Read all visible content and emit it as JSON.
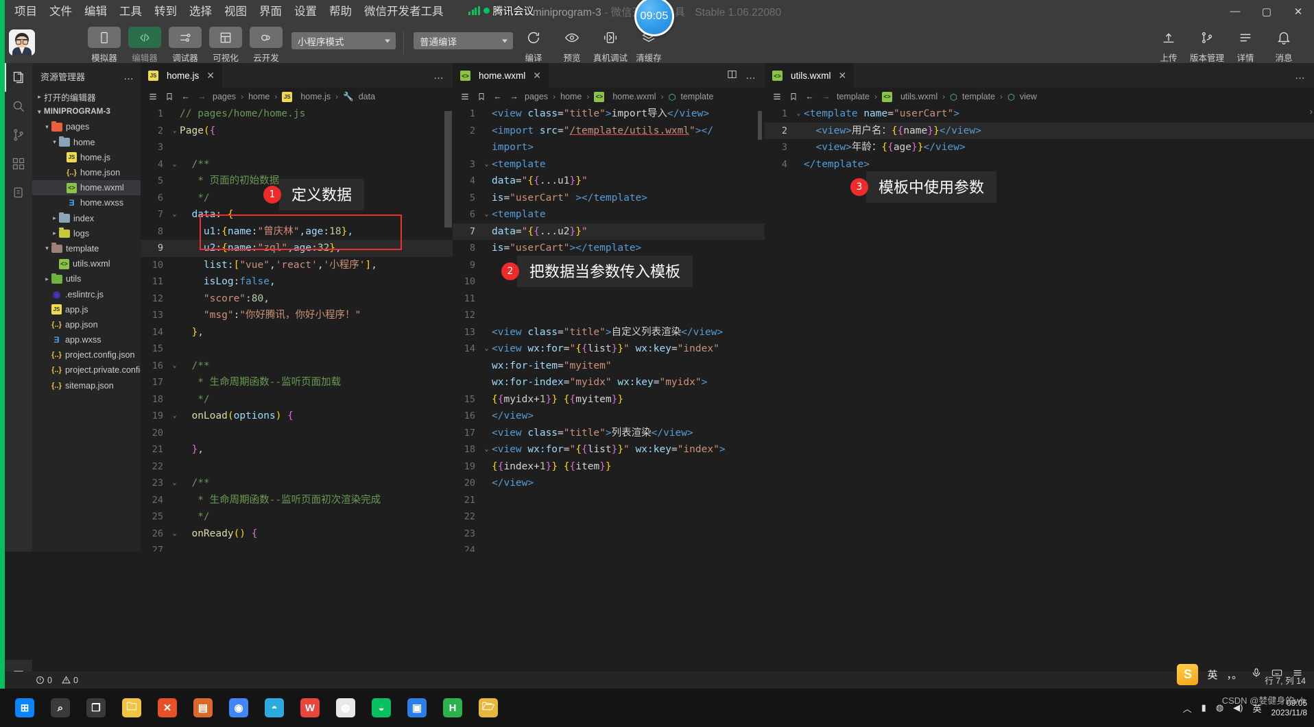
{
  "window": {
    "title_project": "miniprogram-3",
    "title_sep": " - ",
    "title_app": "微信开发者工具",
    "title_version": "Stable 1.06.22080",
    "minimize": "—",
    "maximize": "▢",
    "close": "✕"
  },
  "overlay": {
    "meeting_label": "腾讯会议",
    "clock": "09:05"
  },
  "menubar": {
    "items": [
      "项目",
      "文件",
      "编辑",
      "工具",
      "转到",
      "选择",
      "视图",
      "界面",
      "设置",
      "帮助",
      "微信开发者工具"
    ]
  },
  "toolbar": {
    "buttons": [
      {
        "label": "模拟器",
        "icon": "phone-icon",
        "active": false
      },
      {
        "label": "编辑器",
        "icon": "code-icon",
        "active": true
      },
      {
        "label": "调试器",
        "icon": "sliders-icon",
        "active": false
      },
      {
        "label": "可视化",
        "icon": "layout-icon",
        "active": false
      },
      {
        "label": "云开发",
        "icon": "cloud-icon",
        "active": false
      }
    ],
    "mode_select": "小程序模式",
    "compile_select": "普通编译",
    "actions": [
      {
        "label": "编译",
        "icon": "refresh-icon"
      },
      {
        "label": "预览",
        "icon": "eye-icon"
      },
      {
        "label": "真机调试",
        "icon": "device-debug-icon"
      },
      {
        "label": "清缓存",
        "icon": "layers-icon"
      }
    ],
    "right_actions": [
      {
        "label": "上传",
        "icon": "upload-icon"
      },
      {
        "label": "版本管理",
        "icon": "branch-icon"
      },
      {
        "label": "详情",
        "icon": "details-icon"
      },
      {
        "label": "消息",
        "icon": "bell-icon"
      }
    ]
  },
  "activity_bar": {
    "items": [
      {
        "name": "explorer-icon",
        "glyph": "files"
      },
      {
        "name": "search-icon",
        "glyph": "search"
      },
      {
        "name": "source-control-icon",
        "glyph": "branch"
      },
      {
        "name": "extensions-icon",
        "glyph": "blocks"
      },
      {
        "name": "debug-icon",
        "glyph": "bug"
      }
    ],
    "bottom": {
      "name": "menu-icon",
      "glyph": "list"
    }
  },
  "explorer": {
    "title": "资源管理器",
    "more": "…",
    "open_editors": "打开的编辑器",
    "project_name": "MINIPROGRAM-3",
    "tree": [
      {
        "label": "pages",
        "depth": 1,
        "type": "folder",
        "color": "#e8603c",
        "arrow": "▾"
      },
      {
        "label": "home",
        "depth": 2,
        "type": "folder",
        "color": "#8aa4b8",
        "arrow": "▾"
      },
      {
        "label": "home.js",
        "depth": 3,
        "type": "js",
        "arrow": ""
      },
      {
        "label": "home.json",
        "depth": 3,
        "type": "json",
        "arrow": ""
      },
      {
        "label": "home.wxml",
        "depth": 3,
        "type": "wxml",
        "arrow": "",
        "selected": true
      },
      {
        "label": "home.wxss",
        "depth": 3,
        "type": "wxss",
        "arrow": ""
      },
      {
        "label": "index",
        "depth": 2,
        "type": "folder",
        "color": "#8aa4b8",
        "arrow": "▸"
      },
      {
        "label": "logs",
        "depth": 2,
        "type": "folder",
        "color": "#c8c83c",
        "arrow": "▸"
      },
      {
        "label": "template",
        "depth": 1,
        "type": "folder",
        "color": "#9b8274",
        "arrow": "▾"
      },
      {
        "label": "utils.wxml",
        "depth": 2,
        "type": "wxml",
        "arrow": ""
      },
      {
        "label": "utils",
        "depth": 1,
        "type": "folder",
        "color": "#6cb33f",
        "arrow": "▸"
      },
      {
        "label": ".eslintrc.js",
        "depth": 1,
        "type": "eslint",
        "arrow": ""
      },
      {
        "label": "app.js",
        "depth": 1,
        "type": "js",
        "arrow": ""
      },
      {
        "label": "app.json",
        "depth": 1,
        "type": "json",
        "arrow": ""
      },
      {
        "label": "app.wxss",
        "depth": 1,
        "type": "wxss",
        "arrow": ""
      },
      {
        "label": "project.config.json",
        "depth": 1,
        "type": "json",
        "arrow": ""
      },
      {
        "label": "project.private.config.json",
        "depth": 1,
        "type": "json",
        "arrow": ""
      },
      {
        "label": "sitemap.json",
        "depth": 1,
        "type": "json",
        "arrow": ""
      }
    ]
  },
  "editor_js": {
    "tab": {
      "label": "home.js",
      "close": "✕"
    },
    "tab_more": "…",
    "breadcrumb": [
      "pages",
      "home",
      "home.js",
      "data"
    ],
    "lines": [
      {
        "n": "1",
        "fold": "",
        "html": "<span class='t-cmt'>// pages/home/home.js</span>"
      },
      {
        "n": "2",
        "fold": "⌄",
        "html": "<span class='t-fn'>Page</span><span class='t-br1'>(</span><span class='t-br2'>{</span>"
      },
      {
        "n": "3",
        "fold": "",
        "html": ""
      },
      {
        "n": "4",
        "fold": "⌄",
        "html": "  <span class='t-cmt'>/**</span>"
      },
      {
        "n": "5",
        "fold": "",
        "html": "   <span class='t-cmt'>* 页面的初始数据</span>"
      },
      {
        "n": "6",
        "fold": "",
        "html": "   <span class='t-cmt'>*/</span>"
      },
      {
        "n": "7",
        "fold": "⌄",
        "html": "  <span class='t-var'>data</span><span class='t-pln'>: </span><span class='t-br1'>{</span>"
      },
      {
        "n": "8",
        "fold": "",
        "html": "    <span class='t-var'>u1</span><span class='t-pln'>:</span><span class='t-br1'>{</span><span class='t-var'>name</span><span class='t-pln'>:</span><span class='t-str'>\"曾庆林\"</span><span class='t-var'>,age</span><span class='t-pln'>:</span><span class='t-num'>18</span><span class='t-br1'>}</span><span class='t-var'>,</span>"
      },
      {
        "n": "9",
        "fold": "",
        "html": "    <span class='t-var'>u2</span><span class='t-pln'>:</span><span class='t-br1'>{</span><span class='t-var'>name</span><span class='t-pln'>:</span><span class='t-str'>\"zql\"</span><span class='t-var'>,age</span><span class='t-pln'>:</span><span class='t-num'>32</span><span class='t-br1'>}</span><span class='t-var'>,</span>",
        "hl": true
      },
      {
        "n": "10",
        "fold": "",
        "html": "    <span class='t-var'>list</span><span class='t-pln'>:</span><span class='t-br1'>[</span><span class='t-str'>\"vue\"</span><span class='t-pln'>,</span><span class='t-str'>'react'</span><span class='t-pln'>,</span><span class='t-str'>'小程序'</span><span class='t-br1'>]</span><span class='t-var'>,</span>"
      },
      {
        "n": "11",
        "fold": "",
        "html": "    <span class='t-var'>isLog</span><span class='t-pln'>:</span><span class='t-lit'>false</span><span class='t-var'>,</span>"
      },
      {
        "n": "12",
        "fold": "",
        "html": "    <span class='t-str'>\"score\"</span><span class='t-pln'>:</span><span class='t-num'>80</span><span class='t-var'>,</span>"
      },
      {
        "n": "13",
        "fold": "",
        "html": "    <span class='t-str'>\"msg\"</span><span class='t-pln'>:</span><span class='t-str'>\"你好腾讯，你好小程序！\"</span>"
      },
      {
        "n": "14",
        "fold": "",
        "html": "  <span class='t-br1'>}</span><span class='t-var'>,</span>"
      },
      {
        "n": "15",
        "fold": "",
        "html": ""
      },
      {
        "n": "16",
        "fold": "⌄",
        "html": "  <span class='t-cmt'>/**</span>"
      },
      {
        "n": "17",
        "fold": "",
        "html": "   <span class='t-cmt'>* 生命周期函数--监听页面加载</span>"
      },
      {
        "n": "18",
        "fold": "",
        "html": "   <span class='t-cmt'>*/</span>"
      },
      {
        "n": "19",
        "fold": "⌄",
        "html": "  <span class='t-fn'>onLoad</span><span class='t-br1'>(</span><span class='t-var'>options</span><span class='t-br1'>)</span><span class='t-pln'> </span><span class='t-br2'>{</span>"
      },
      {
        "n": "20",
        "fold": "",
        "html": ""
      },
      {
        "n": "21",
        "fold": "",
        "html": "  <span class='t-br2'>}</span><span class='t-var'>,</span>"
      },
      {
        "n": "22",
        "fold": "",
        "html": ""
      },
      {
        "n": "23",
        "fold": "⌄",
        "html": "  <span class='t-cmt'>/**</span>"
      },
      {
        "n": "24",
        "fold": "",
        "html": "   <span class='t-cmt'>* 生命周期函数--监听页面初次渲染完成</span>"
      },
      {
        "n": "25",
        "fold": "",
        "html": "   <span class='t-cmt'>*/</span>"
      },
      {
        "n": "26",
        "fold": "⌄",
        "html": "  <span class='t-fn'>onReady</span><span class='t-br1'>()</span><span class='t-pln'> </span><span class='t-br2'>{</span>"
      },
      {
        "n": "27",
        "fold": "",
        "html": ""
      }
    ]
  },
  "editor_wxml": {
    "tab": {
      "label": "home.wxml",
      "close": "✕"
    },
    "split_icon": "split-editor-icon",
    "tab_more": "…",
    "breadcrumb": [
      "pages",
      "home",
      "home.wxml",
      "template"
    ],
    "lines": [
      {
        "n": "1",
        "fold": "",
        "html": "<span class='t-tag'>&lt;view</span> <span class='t-attr'>class</span>=<span class='t-str'>\"title\"</span><span class='t-tag'>&gt;</span><span class='t-pln'>import导入</span><span class='t-tag'>&lt;/view&gt;</span>"
      },
      {
        "n": "2",
        "fold": "",
        "html": "<span class='t-tag'>&lt;import</span> <span class='t-attr'>src</span>=<span class='t-str'>\"</span><span class='t-link'>/template/utils.wxml</span><span class='t-str'>\"</span><span class='t-tag'>&gt;&lt;/</span>"
      },
      {
        "n": "",
        "fold": "",
        "html": "<span class='t-tag'>import&gt;</span>"
      },
      {
        "n": "3",
        "fold": "⌄",
        "html": "<span class='t-tag'>&lt;template</span>"
      },
      {
        "n": "4",
        "fold": "",
        "html": "<span class='t-attr'>data</span>=<span class='t-str'>\"</span><span class='t-br1'>{</span><span class='t-br2'>{</span><span class='t-pln'>...u1</span><span class='t-br2'>}</span><span class='t-br1'>}</span><span class='t-str'>\"</span>"
      },
      {
        "n": "5",
        "fold": "",
        "html": "<span class='t-attr'>is</span>=<span class='t-str'>\"userCart\"</span> <span class='t-tag'>&gt;&lt;/template&gt;</span>"
      },
      {
        "n": "6",
        "fold": "⌄",
        "html": "<span class='t-tag'>&lt;template</span>"
      },
      {
        "n": "7",
        "fold": "",
        "html": "<span class='t-attr'>data</span>=<span class='t-str'>\"</span><span class='t-br1'>{</span><span class='t-br2'>{</span><span class='t-pln'>...u2</span><span class='t-br2'>}</span><span class='t-br1'>}</span><span class='t-str'>\"</span>",
        "hl": true
      },
      {
        "n": "8",
        "fold": "",
        "html": "<span class='t-attr'>is</span>=<span class='t-str'>\"userCart\"</span><span class='t-tag'>&gt;&lt;/template&gt;</span>"
      },
      {
        "n": "9",
        "fold": "",
        "html": ""
      },
      {
        "n": "10",
        "fold": "",
        "html": ""
      },
      {
        "n": "11",
        "fold": "",
        "html": ""
      },
      {
        "n": "12",
        "fold": "",
        "html": ""
      },
      {
        "n": "13",
        "fold": "",
        "html": "<span class='t-tag'>&lt;view</span> <span class='t-attr'>class</span>=<span class='t-str'>\"title\"</span><span class='t-tag'>&gt;</span><span class='t-pln'>自定义列表渲染</span><span class='t-tag'>&lt;/view&gt;</span>"
      },
      {
        "n": "14",
        "fold": "⌄",
        "html": "<span class='t-tag'>&lt;view</span> <span class='t-attr'>wx:for</span>=<span class='t-str'>\"</span><span class='t-br1'>{</span><span class='t-br2'>{</span><span class='t-pln'>list</span><span class='t-br2'>}</span><span class='t-br1'>}</span><span class='t-str'>\"</span> <span class='t-attr'>wx:key</span>=<span class='t-str'>\"index\"</span>"
      },
      {
        "n": "",
        "fold": "",
        "html": "<span class='t-attr'>wx:for-item</span>=<span class='t-str'>\"myitem\"</span>"
      },
      {
        "n": "",
        "fold": "",
        "html": "<span class='t-attr'>wx:for-index</span>=<span class='t-str'>\"myidx\"</span> <span class='t-attr'>wx:key</span>=<span class='t-str'>\"myidx\"</span><span class='t-tag'>&gt;</span>"
      },
      {
        "n": "15",
        "fold": "",
        "html": "<span class='t-br1'>{</span><span class='t-br2'>{</span><span class='t-pln'>myidx+</span><span class='t-num'>1</span><span class='t-br2'>}</span><span class='t-br1'>}</span> <span class='t-br1'>{</span><span class='t-br2'>{</span><span class='t-pln'>myitem</span><span class='t-br2'>}</span><span class='t-br1'>}</span>"
      },
      {
        "n": "16",
        "fold": "",
        "html": "<span class='t-tag'>&lt;/view&gt;</span>"
      },
      {
        "n": "17",
        "fold": "",
        "html": "<span class='t-tag'>&lt;view</span> <span class='t-attr'>class</span>=<span class='t-str'>\"title\"</span><span class='t-tag'>&gt;</span><span class='t-pln'>列表渲染</span><span class='t-tag'>&lt;/view&gt;</span>"
      },
      {
        "n": "18",
        "fold": "⌄",
        "html": "<span class='t-tag'>&lt;view</span> <span class='t-attr'>wx:for</span>=<span class='t-str'>\"</span><span class='t-br1'>{</span><span class='t-br2'>{</span><span class='t-pln'>list</span><span class='t-br2'>}</span><span class='t-br1'>}</span><span class='t-str'>\"</span> <span class='t-attr'>wx:key</span>=<span class='t-str'>\"index\"</span><span class='t-tag'>&gt;</span>"
      },
      {
        "n": "19",
        "fold": "",
        "html": "<span class='t-br1'>{</span><span class='t-br2'>{</span><span class='t-pln'>index+</span><span class='t-num'>1</span><span class='t-br2'>}</span><span class='t-br1'>}</span> <span class='t-br1'>{</span><span class='t-br2'>{</span><span class='t-pln'>item</span><span class='t-br2'>}</span><span class='t-br1'>}</span>"
      },
      {
        "n": "20",
        "fold": "",
        "html": "<span class='t-tag'>&lt;/view&gt;</span>"
      },
      {
        "n": "21",
        "fold": "",
        "html": ""
      },
      {
        "n": "22",
        "fold": "",
        "html": ""
      },
      {
        "n": "23",
        "fold": "",
        "html": ""
      },
      {
        "n": "24",
        "fold": "",
        "html": ""
      }
    ]
  },
  "editor_utils": {
    "tab": {
      "label": "utils.wxml",
      "close": "✕"
    },
    "tab_more": "…",
    "breadcrumb": [
      "template",
      "utils.wxml",
      "template",
      "view"
    ],
    "lines": [
      {
        "n": "1",
        "fold": "⌄",
        "html": "<span class='t-tag'>&lt;template</span> <span class='t-attr'>name</span>=<span class='t-str'>\"userCart\"</span><span class='t-tag'>&gt;</span>"
      },
      {
        "n": "2",
        "fold": "",
        "html": "  <span class='t-tag'>&lt;view&gt;</span><span class='t-pln'>用户名：</span><span class='t-br1'>{</span><span class='t-br2'>{</span><span class='t-pln'>name</span><span class='t-br2'>}</span><span class='t-br1'>}</span><span class='t-tag'>&lt;/view&gt;</span>",
        "hl": true
      },
      {
        "n": "3",
        "fold": "",
        "html": "  <span class='t-tag'>&lt;view&gt;</span><span class='t-pln'>年龄：</span><span class='t-br1'>{</span><span class='t-br2'>{</span><span class='t-pln'>age</span><span class='t-br2'>}</span><span class='t-br1'>}</span><span class='t-tag'>&lt;/view&gt;</span>"
      },
      {
        "n": "4",
        "fold": "",
        "html": "<span class='t-tag'>&lt;/template&gt;</span>"
      }
    ]
  },
  "callouts": [
    {
      "num": "1",
      "text": "定义数据"
    },
    {
      "num": "2",
      "text": "把数据当参数传入模板"
    },
    {
      "num": "3",
      "text": "模板中使用参数"
    }
  ],
  "statusbar": {
    "errors": "0",
    "warnings": "0",
    "error_icon": "error-circle-icon",
    "warning_icon": "warning-triangle-icon",
    "position": "行 7, 列 14"
  },
  "ime": {
    "lang": "英",
    "punct": "，。",
    "mic_icon": "microphone-icon",
    "keyboard_icon": "keyboard-icon",
    "menu_icon": "hamburger-icon"
  },
  "taskbar": {
    "items": [
      {
        "name": "start-button",
        "glyph": "⊞",
        "color": "#0a84ff"
      },
      {
        "name": "search-taskbar",
        "glyph": "⌕",
        "color": "#3a3a3a"
      },
      {
        "name": "task-view",
        "glyph": "❐",
        "color": "#3a3a3a"
      },
      {
        "name": "file-explorer",
        "glyph": "🗀",
        "color": "#f5c344"
      },
      {
        "name": "xmind-app",
        "glyph": "✕",
        "color": "#e8502a"
      },
      {
        "name": "clipboard-app",
        "glyph": "▤",
        "color": "#d96a2b"
      },
      {
        "name": "chrome-browser",
        "glyph": "◉",
        "color": "#4285f4"
      },
      {
        "name": "edge-browser",
        "glyph": "◓",
        "color": "#2aaadd"
      },
      {
        "name": "wps-office",
        "glyph": "W",
        "color": "#e8453c"
      },
      {
        "name": "devtools-app",
        "glyph": "◍",
        "color": "#e8e8e8"
      },
      {
        "name": "wechat-app",
        "glyph": "◒",
        "color": "#07c160"
      },
      {
        "name": "tencent-meeting",
        "glyph": "▣",
        "color": "#2a7fe8"
      },
      {
        "name": "hbuilder-app",
        "glyph": "H",
        "color": "#2bb24c"
      },
      {
        "name": "folder-app",
        "glyph": "🗁",
        "color": "#e8b83c"
      }
    ],
    "tray": {
      "up_arrow": "︿",
      "battery": "▮",
      "network": "◍",
      "volume": "◀)",
      "lang": "英",
      "date_line1": "09:05",
      "date_line2": "2023/11/8"
    },
    "watermark": "CSDN @婪健身的wb"
  }
}
